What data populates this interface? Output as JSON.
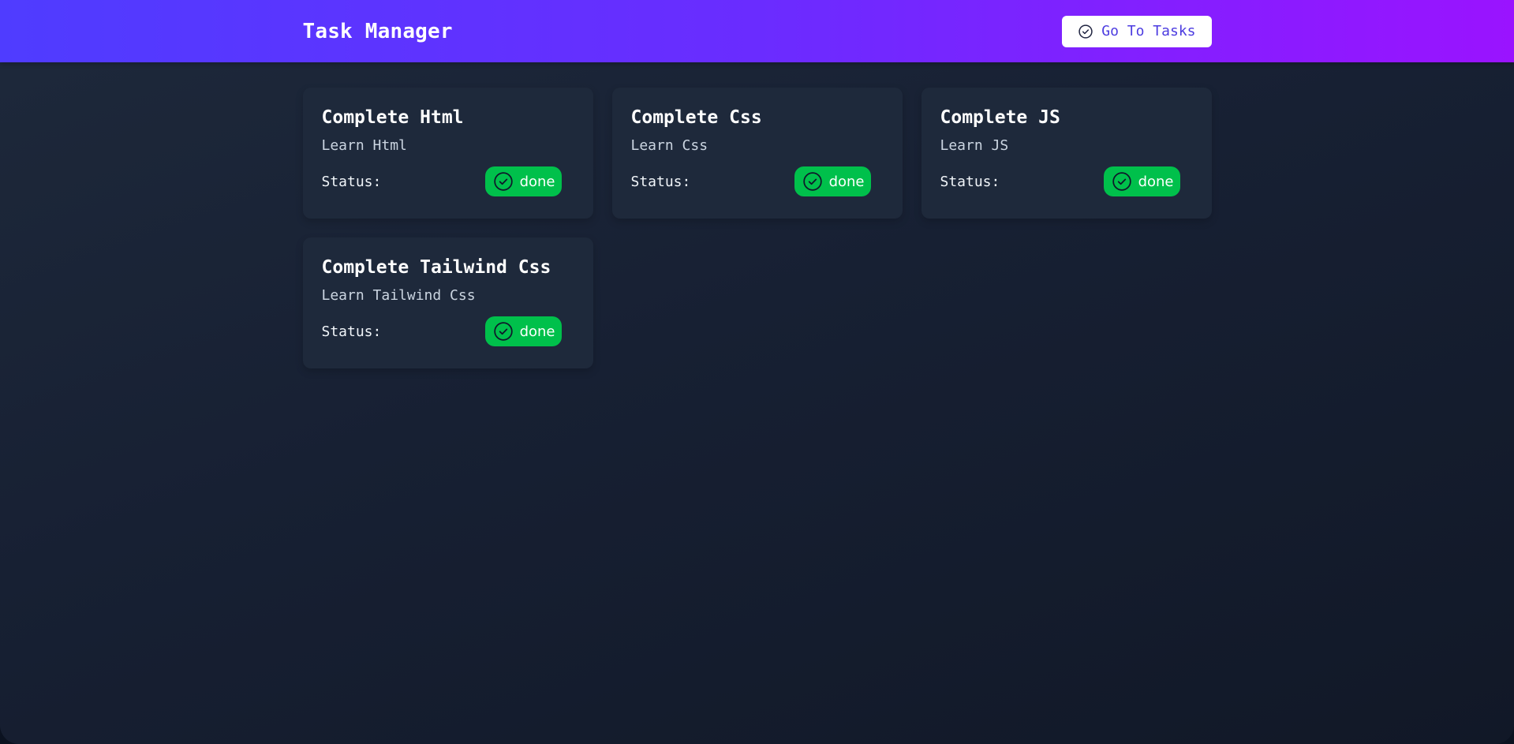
{
  "header": {
    "title": "Task Manager",
    "go_button_label": "Go To Tasks",
    "go_button_icon": "check-circle-icon"
  },
  "colors": {
    "header_gradient_start": "#4f3cff",
    "header_gradient_end": "#9a13ff",
    "card_background": "#1e293b",
    "status_done": "#00c04b"
  },
  "tasks": [
    {
      "title": "Complete Html",
      "description": "Learn Html",
      "status_label": "Status:",
      "status": "done",
      "status_icon": "check-circle-icon"
    },
    {
      "title": "Complete Css",
      "description": "Learn Css",
      "status_label": "Status:",
      "status": "done",
      "status_icon": "check-circle-icon"
    },
    {
      "title": "Complete JS",
      "description": "Learn JS",
      "status_label": "Status:",
      "status": "done",
      "status_icon": "check-circle-icon"
    },
    {
      "title": "Complete Tailwind Css",
      "description": "Learn Tailwind Css",
      "status_label": "Status:",
      "status": "done",
      "status_icon": "check-circle-icon"
    }
  ]
}
